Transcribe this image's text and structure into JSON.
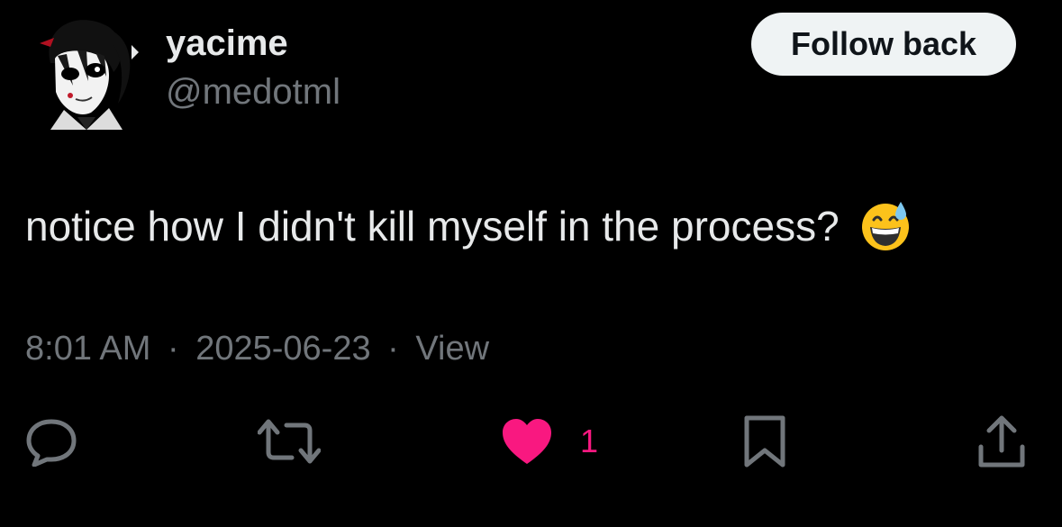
{
  "tweet": {
    "author": {
      "display_name": "yacime",
      "handle": "@medotml",
      "avatar_icon": "anime-character-avatar"
    },
    "follow_button_label": "Follow back",
    "text": "notice how I didn't kill myself in the process?",
    "emoji": "grinning-face-with-sweat-emoji",
    "meta": {
      "time": "8:01 AM",
      "separator": "·",
      "date": "2025-06-23",
      "views_label": "View"
    },
    "actions": {
      "reply_icon": "reply-icon",
      "retweet_icon": "retweet-icon",
      "like_icon": "heart-icon",
      "like_count": "1",
      "like_color": "#f91880",
      "bookmark_icon": "bookmark-icon",
      "share_icon": "share-icon"
    }
  }
}
